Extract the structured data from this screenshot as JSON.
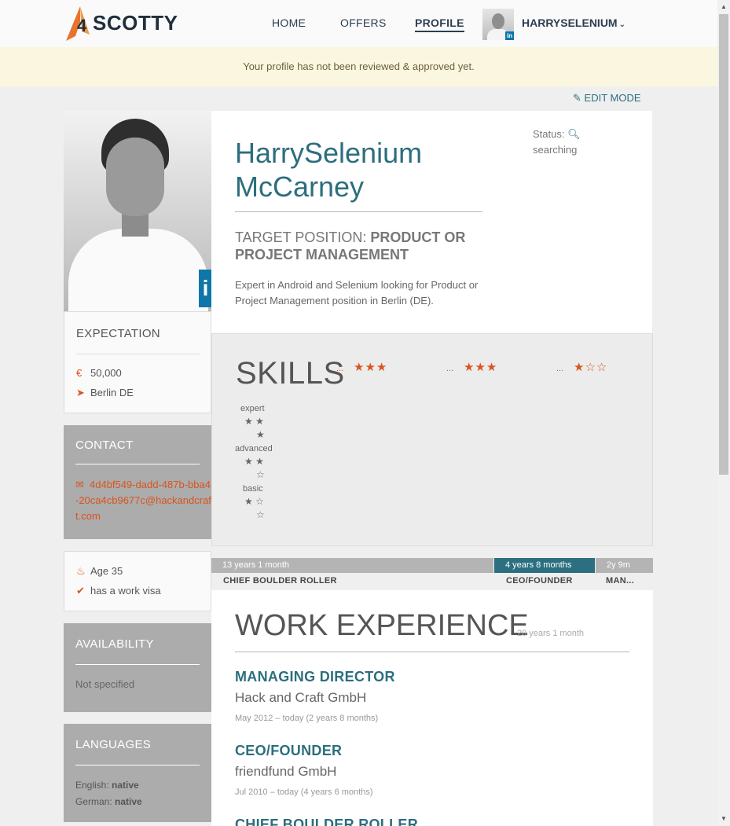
{
  "header": {
    "logo_text": "SCOTTY",
    "logo_mark": "4",
    "nav": {
      "home": "HOME",
      "offers": "OFFERS",
      "profile": "PROFILE"
    },
    "user": "HARRYSELENIUM",
    "avatar_badge": "in"
  },
  "notice": "Your profile has not been reviewed & approved yet.",
  "edit_mode": "EDIT MODE",
  "profile": {
    "first_name": "HarrySelenium",
    "last_name": "McCarney",
    "target_prefix": "TARGET POSITION:",
    "target_value": "PRODUCT OR PROJECT MANAGEMENT",
    "summary": "Expert in Android and Selenium looking for Product or Project Management position in Berlin (DE).",
    "status_label": "Status:",
    "status_value": "searching",
    "photo_badge": "i"
  },
  "expectation": {
    "title": "EXPECTATION",
    "salary": "50,000",
    "location": "Berlin DE"
  },
  "contact": {
    "title": "CONTACT",
    "email": "4d4bf549-dadd-487b-bba4-20ca4cb9677c@hackandcraft.com"
  },
  "personal": {
    "age": "Age 35",
    "visa": "has a work visa"
  },
  "availability": {
    "title": "AVAILABILITY",
    "value": "Not specified"
  },
  "languages": {
    "title": "LANGUAGES",
    "items": [
      {
        "name": "English:",
        "level": "native"
      },
      {
        "name": "German:",
        "level": "native"
      }
    ]
  },
  "skills": {
    "title": "SKILLS",
    "items": [
      {
        "name": "...",
        "rating": 3,
        "of": 3
      },
      {
        "name": "...",
        "rating": 3,
        "of": 3
      },
      {
        "name": "...",
        "rating": 1,
        "of": 3
      }
    ],
    "legend": [
      {
        "label": "expert",
        "rating": 3
      },
      {
        "label": "advanced",
        "rating": 2
      },
      {
        "label": "basic",
        "rating": 1
      }
    ]
  },
  "timeline": [
    {
      "duration": "13 years 1 month",
      "label": "CHIEF BOULDER ROLLER",
      "color": "#b4b4b4"
    },
    {
      "duration": "4 years 8 months",
      "label": "CEO/FOUNDER",
      "color": "#2b6f80"
    },
    {
      "duration": "2y 9m",
      "label": "MAN...",
      "color": "#b4b4b4"
    }
  ],
  "work": {
    "title": "WORK EXPERIENCE",
    "total": "20 years 1 month",
    "jobs": [
      {
        "title": "MANAGING DIRECTOR",
        "company": "Hack and Craft GmbH",
        "dates": "May 2012 – today (2 years 8 months)"
      },
      {
        "title": "CEO/FOUNDER",
        "company": "friendfund GmbH",
        "dates": "Jul 2010 – today (4 years 6 months)"
      },
      {
        "title": "CHIEF BOULDER ROLLER",
        "company": "",
        "dates": ""
      }
    ]
  },
  "colors": {
    "accent": "#2c6e7e",
    "orange": "#d9541e",
    "grey_card": "#acacac"
  }
}
